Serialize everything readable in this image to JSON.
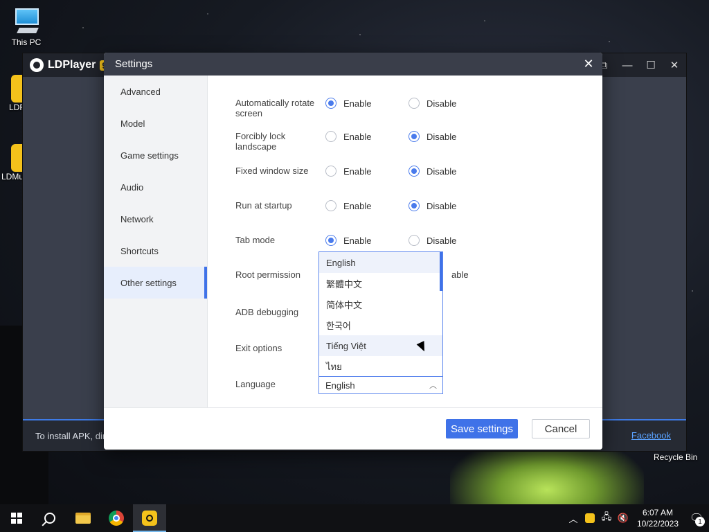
{
  "desktop": {
    "this_pc_label": "This PC",
    "recycle_bin_label": "Recycle Bin",
    "side_icon_1_label": "LDF",
    "side_icon_2_label": "LDMu"
  },
  "ldplayer": {
    "title": "LDPlayer",
    "version_badge": "9",
    "bottom_text": "To install APK, dir",
    "facebook_link": "Facebook"
  },
  "dialog": {
    "title": "Settings",
    "sidebar": [
      {
        "label": "Advanced"
      },
      {
        "label": "Model"
      },
      {
        "label": "Game settings"
      },
      {
        "label": "Audio"
      },
      {
        "label": "Network"
      },
      {
        "label": "Shortcuts"
      },
      {
        "label": "Other settings"
      }
    ],
    "active_sidebar": "Other settings",
    "enable_label": "Enable",
    "disable_label": "Disable",
    "rows": [
      {
        "label": "Automatically rotate screen",
        "value": "Enable"
      },
      {
        "label": "Forcibly lock landscape",
        "value": "Disable"
      },
      {
        "label": "Fixed window size",
        "value": "Disable"
      },
      {
        "label": "Run at startup",
        "value": "Disable"
      },
      {
        "label": "Tab mode",
        "value": "Enable"
      },
      {
        "label": "Root permission",
        "value": "Disable"
      },
      {
        "label": "ADB debugging",
        "value": null
      },
      {
        "label": "Exit options",
        "value": null
      }
    ],
    "root_disable_partial": "able",
    "language_label": "Language",
    "language_value": "English",
    "language_options": [
      "English",
      "繁體中文",
      "简体中文",
      "한국어",
      "Tiếng Việt",
      "ไทย"
    ],
    "save_button": "Save settings",
    "cancel_button": "Cancel"
  },
  "taskbar": {
    "time": "6:07 AM",
    "date": "10/22/2023",
    "notification_count": "1"
  },
  "colors": {
    "accent": "#3f72e8",
    "titlebar": "#3a3e4a",
    "sidebar_bg": "#f2f3f5"
  }
}
